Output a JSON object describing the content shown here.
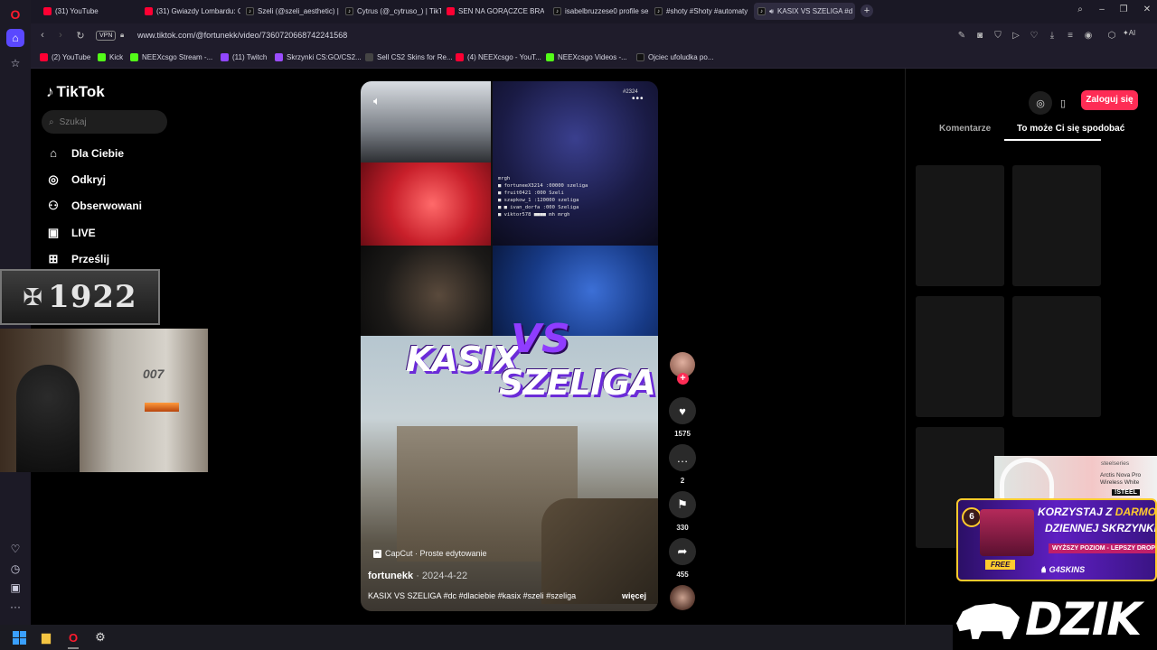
{
  "browser": {
    "tabs": [
      {
        "label": "(31) YouTube",
        "icon": "youtube-icon"
      },
      {
        "label": "(31) Gwiazdy Lombardu: C",
        "icon": "youtube-icon"
      },
      {
        "label": "Szeli (@szeli_aesthetic) | T",
        "icon": "tiktok-icon"
      },
      {
        "label": "Cytrus (@_cytruso_) | TikTo",
        "icon": "tiktok-icon"
      },
      {
        "label": "SEN NA GORĄCZCE BRAC",
        "icon": "youtube-icon"
      },
      {
        "label": "isabelbruzzese0 profile se",
        "icon": "tiktok-icon"
      },
      {
        "label": "#shoty #Shoty #automaty",
        "icon": "tiktok-icon"
      },
      {
        "label": "KASIX VS SZELIGA #d",
        "icon": "tiktok-icon"
      }
    ],
    "url": "www.tiktok.com/@fortunekk/video/7360720668742241568",
    "vpn_label": "VPN",
    "ai_label": "AI",
    "bookmarks": [
      {
        "label": "(2) YouTube",
        "icon": "youtube-icon"
      },
      {
        "label": "Kick",
        "icon": "kick-icon"
      },
      {
        "label": "NEEXcsgo Stream -...",
        "icon": "kick-icon"
      },
      {
        "label": "(11) Twitch",
        "icon": "twitch-icon"
      },
      {
        "label": "Skrzynki CS:GO/CS2...",
        "icon": "skrzynki-icon"
      },
      {
        "label": "Sell CS2 Skins for Re...",
        "icon": "cs2-icon"
      },
      {
        "label": "(4) NEEXcsgo - YouT...",
        "icon": "youtube-icon"
      },
      {
        "label": "NEEXcsgo Videos -...",
        "icon": "kick-icon"
      },
      {
        "label": "Ojciec ufoludka po...",
        "icon": "tiktok-icon"
      }
    ]
  },
  "tiktok": {
    "logo_text": "TikTok",
    "search_placeholder": "Szukaj",
    "nav": [
      {
        "label": "Dla Ciebie",
        "icon": "home-icon"
      },
      {
        "label": "Odkryj",
        "icon": "compass-icon"
      },
      {
        "label": "Obserwowani",
        "icon": "following-icon"
      },
      {
        "label": "LIVE",
        "icon": "live-icon"
      },
      {
        "label": "Prześlij",
        "icon": "upload-icon"
      }
    ],
    "video": {
      "title_kasix": "KASIX",
      "title_vs": "VS",
      "title_szeliga": "SZELIGA",
      "stream_counter": "#2324",
      "chat_lines": [
        "mrgh",
        "■ fortuneeX3214 :00000 szeliga",
        "■ fruit0421 :000 Szeli",
        "■ szapkow_1 :120000 szeliga",
        "■ ■ ivan_dorfa :000 Szeliga",
        "■ viktor578 ■■■■ mh mrgh"
      ],
      "capcut_label": "CapCut · Proste edytowanie",
      "author": "fortunekk",
      "date": "· 2024-4-22",
      "caption": "KASIX VS SZELIGA #dc #dlaciebie #kasix #szeli #szeliga",
      "more_label": "więcej"
    },
    "actions": {
      "likes": "1575",
      "comments": "2",
      "saves": "330",
      "shares": "455"
    },
    "right_panel": {
      "login_label": "Zaloguj się",
      "tab_comments": "Komentarze",
      "tab_suggested": "To może Ci się spodobać"
    }
  },
  "overlays": {
    "emblem_text": "1922",
    "cam_sign": "007"
  },
  "ads": {
    "steelseries_brand": "steelseries",
    "steelseries_product_1": "Arctis Nova Pro",
    "steelseries_product_2": "Wireless White",
    "steelseries_code": "!STEEL",
    "g4_line1a": "KORZYSTAJ Z",
    "g4_line1b": "DARMOWEJ",
    "g4_line2": "DZIENNEJ SKRZYNKI!",
    "g4_line3": "WYŻSZY POZIOM - LEPSZY DROP",
    "g4_free": "FREE",
    "g4_logo": "G4SKINS",
    "g4_level": "6",
    "dzik": "DZIK"
  },
  "colors": {
    "tiktok_red": "#fe2c55",
    "opera_accent": "#5a48ff",
    "vs_purple": "#8f3cff",
    "ad_yellow": "#ffcb2e"
  }
}
